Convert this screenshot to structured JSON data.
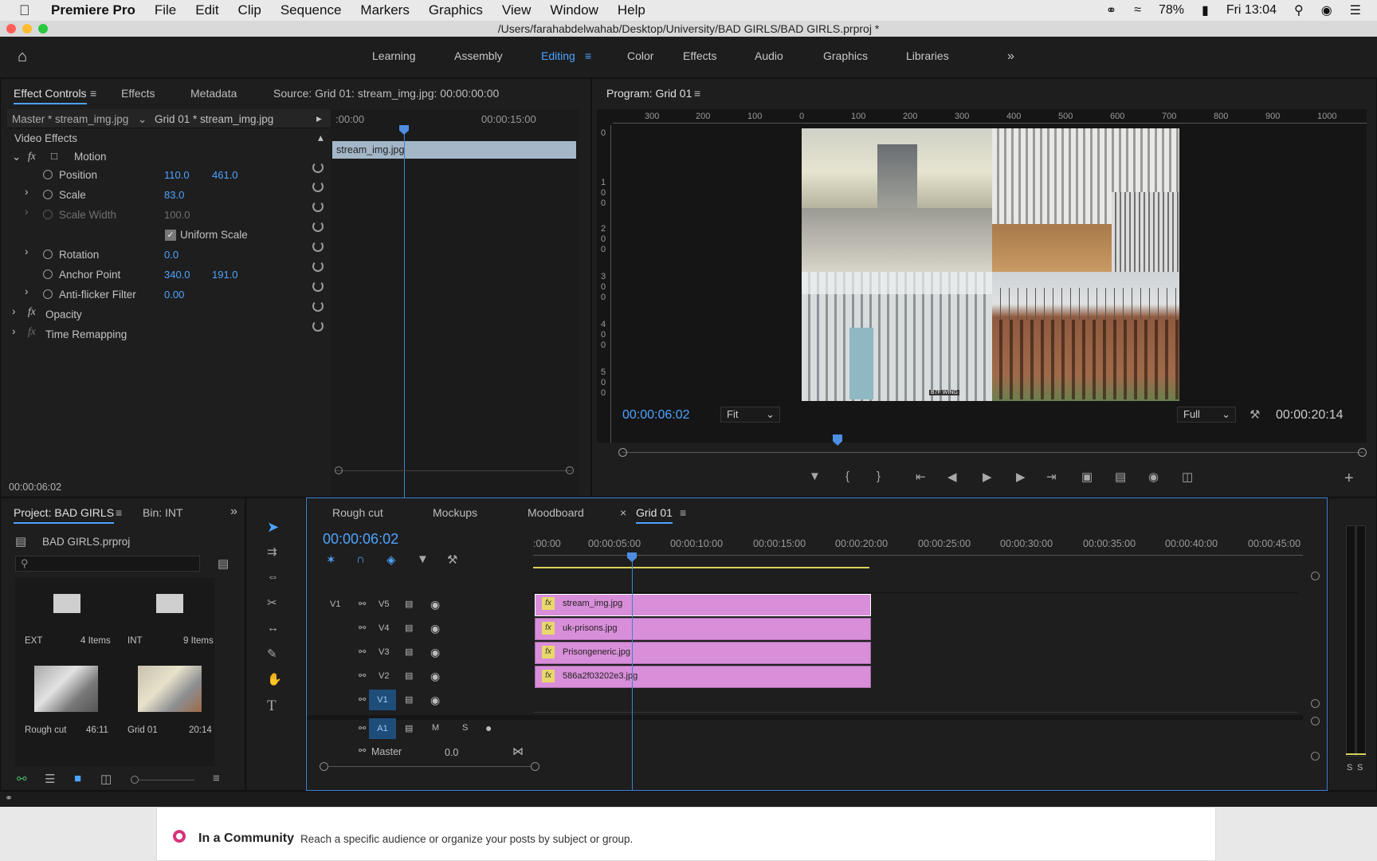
{
  "menubar": {
    "app_name": "Premiere Pro",
    "items": [
      "File",
      "Edit",
      "Clip",
      "Sequence",
      "Markers",
      "Graphics",
      "View",
      "Window",
      "Help"
    ],
    "battery": "78%",
    "clock": "Fri 13:04"
  },
  "window": {
    "path": "/Users/farahabdelwahab/Desktop/University/BAD GIRLS/BAD GIRLS.prproj *"
  },
  "workspaces": [
    "Learning",
    "Assembly",
    "Editing",
    "Color",
    "Effects",
    "Audio",
    "Graphics",
    "Libraries"
  ],
  "active_workspace": "Editing",
  "effect_controls": {
    "tabs": [
      "Effect Controls",
      "Effects",
      "Metadata"
    ],
    "source": "Source: Grid 01: stream_img.jpg: 00:00:00:00",
    "master": "Master * stream_img.jpg",
    "sequence": "Grid 01 * stream_img.jpg",
    "ruler_start": ":00:00",
    "ruler_mid": "00:00:15:00",
    "clip_name": "stream_img.jpg",
    "section": "Video Effects",
    "motion": "Motion",
    "position": {
      "label": "Position",
      "x": "110.0",
      "y": "461.0"
    },
    "scale": {
      "label": "Scale",
      "value": "83.0"
    },
    "scale_width": {
      "label": "Scale Width",
      "value": "100.0"
    },
    "uniform": "Uniform Scale",
    "rotation": {
      "label": "Rotation",
      "value": "0.0"
    },
    "anchor": {
      "label": "Anchor Point",
      "x": "340.0",
      "y": "191.0"
    },
    "antiflicker": {
      "label": "Anti-flicker Filter",
      "value": "0.00"
    },
    "opacity": "Opacity",
    "time_remap": "Time Remapping",
    "timecode": "00:00:06:02"
  },
  "program": {
    "title": "Program: Grid 01",
    "ruler": [
      "300",
      "200",
      "100",
      "0",
      "100",
      "200",
      "300",
      "400",
      "500",
      "600",
      "700",
      "800",
      "900",
      "1000"
    ],
    "vruler": [
      "0",
      "1\n0\n0",
      "2\n0\n0",
      "3\n0\n0",
      "4\n0\n0",
      "5\n0\n0"
    ],
    "timecode": "00:00:06:02",
    "fit": "Fit",
    "quality": "Full",
    "duration": "00:00:20:14",
    "sign_text": "B7F WING"
  },
  "project": {
    "tabs": [
      "Project: BAD GIRLS",
      "Bin: INT"
    ],
    "file": "BAD GIRLS.prproj",
    "bins": [
      {
        "name": "EXT",
        "count": "4 Items"
      },
      {
        "name": "INT",
        "count": "9 Items"
      }
    ],
    "sequences": [
      {
        "name": "Rough cut",
        "dur": "46:11"
      },
      {
        "name": "Grid 01",
        "dur": "20:14"
      }
    ]
  },
  "timeline": {
    "tabs": [
      "Rough cut",
      "Mockups",
      "Moodboard",
      "Grid 01"
    ],
    "timecode": "00:00:06:02",
    "ruler": [
      ":00:00",
      "00:00:05:00",
      "00:00:10:00",
      "00:00:15:00",
      "00:00:20:00",
      "00:00:25:00",
      "00:00:30:00",
      "00:00:35:00",
      "00:00:40:00",
      "00:00:45:00"
    ],
    "tracks": [
      {
        "patch": "V1",
        "name": "V5",
        "clip": "stream_img.jpg"
      },
      {
        "patch": "",
        "name": "V4",
        "clip": "uk-prisons.jpg"
      },
      {
        "patch": "",
        "name": "V3",
        "clip": "Prisongeneric.jpg"
      },
      {
        "patch": "",
        "name": "V2",
        "clip": "586a2f03202e3.jpg"
      },
      {
        "patch": "",
        "name": "V1",
        "clip": ""
      }
    ],
    "audio": {
      "name": "A1",
      "m": "M",
      "s": "S"
    },
    "master": {
      "label": "Master",
      "value": "0.0"
    },
    "meter": [
      "S",
      "S"
    ]
  },
  "web": {
    "title": "In a Community",
    "desc": "Reach a specific audience or organize your posts by subject or group."
  }
}
